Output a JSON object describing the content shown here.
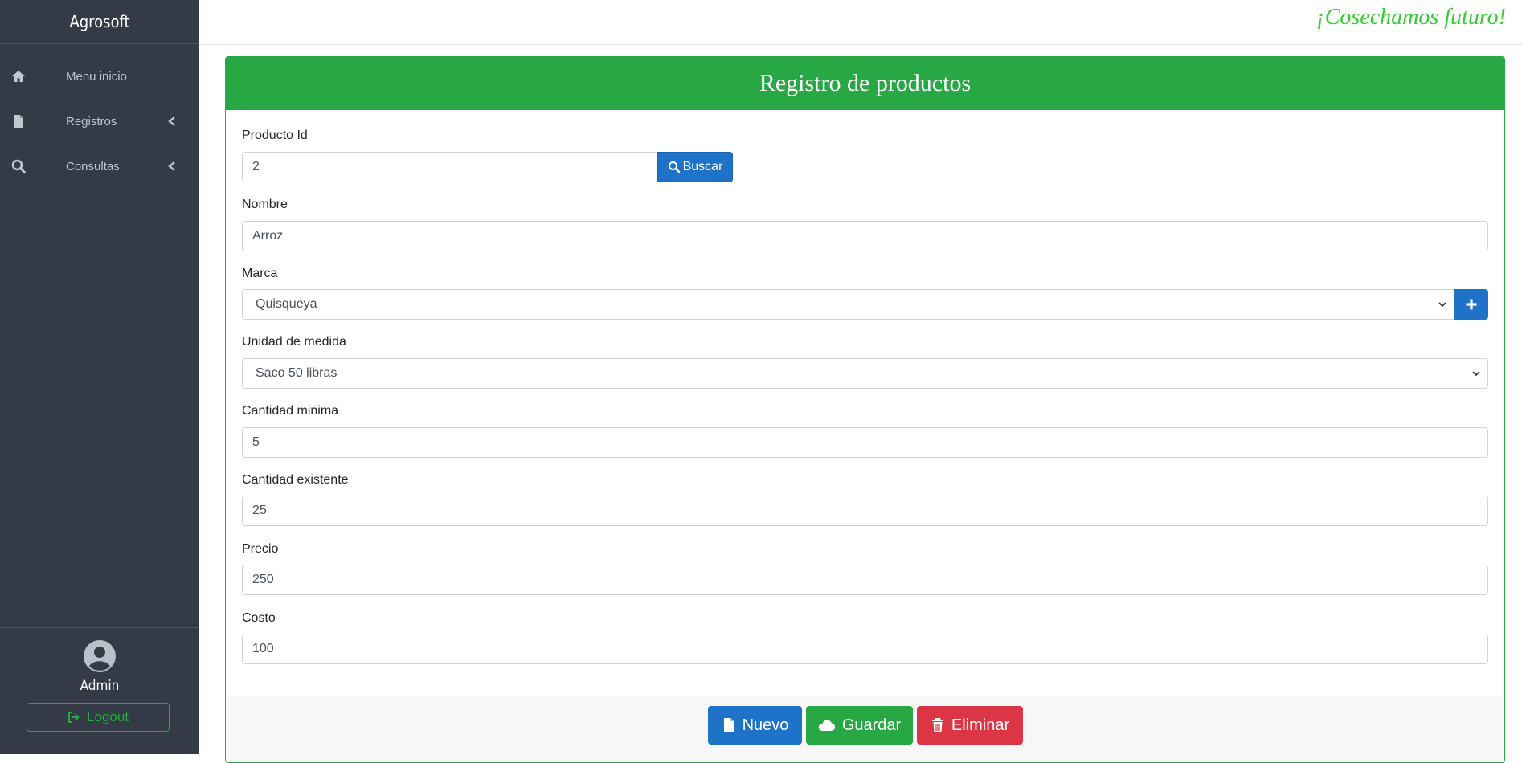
{
  "app": {
    "brand": "Agrosoft",
    "slogan": "¡Cosechamos futuro!"
  },
  "sidebar": {
    "items": [
      {
        "label": "Menu inicio",
        "icon": "home-icon"
      },
      {
        "label": "Registros",
        "icon": "file-icon"
      },
      {
        "label": "Consultas",
        "icon": "search-icon"
      }
    ],
    "user": {
      "name": "Admin"
    },
    "logout_label": "Logout"
  },
  "form": {
    "title": "Registro de productos",
    "producto_id": {
      "label": "Producto Id",
      "value": "2"
    },
    "buscar_label": "Buscar",
    "nombre": {
      "label": "Nombre",
      "value": "Arroz"
    },
    "marca": {
      "label": "Marca",
      "value": "Quisqueya"
    },
    "unidad": {
      "label": "Unidad de medida",
      "value": "Saco 50 libras"
    },
    "cantidad_minima": {
      "label": "Cantidad minima",
      "value": "5"
    },
    "cantidad_existente": {
      "label": "Cantidad existente",
      "value": "25"
    },
    "precio": {
      "label": "Precio",
      "value": "250"
    },
    "costo": {
      "label": "Costo",
      "value": "100"
    }
  },
  "buttons": {
    "nuevo": "Nuevo",
    "guardar": "Guardar",
    "eliminar": "Eliminar"
  },
  "colors": {
    "sidebar": "#343a46",
    "success": "#28a745",
    "primary": "#1e73c8",
    "danger": "#dc3545",
    "slogan": "#33cc33"
  }
}
